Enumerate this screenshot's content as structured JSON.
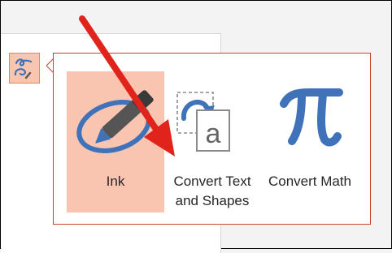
{
  "ink_menu": {
    "trigger_icon": "ink-to-shape-icon",
    "options": [
      {
        "label": "Ink",
        "icon": "ink-pen-icon",
        "selected": true
      },
      {
        "label": "Convert Text and Shapes",
        "icon": "convert-shapes-icon",
        "selected": false
      },
      {
        "label": "Convert Math",
        "icon": "pi-icon",
        "selected": false
      }
    ]
  },
  "colors": {
    "accent_blue": "#3f72b8",
    "selection_fill": "#f9c5b0",
    "callout_border": "#c8442f",
    "annotation_arrow": "#e0231b"
  }
}
